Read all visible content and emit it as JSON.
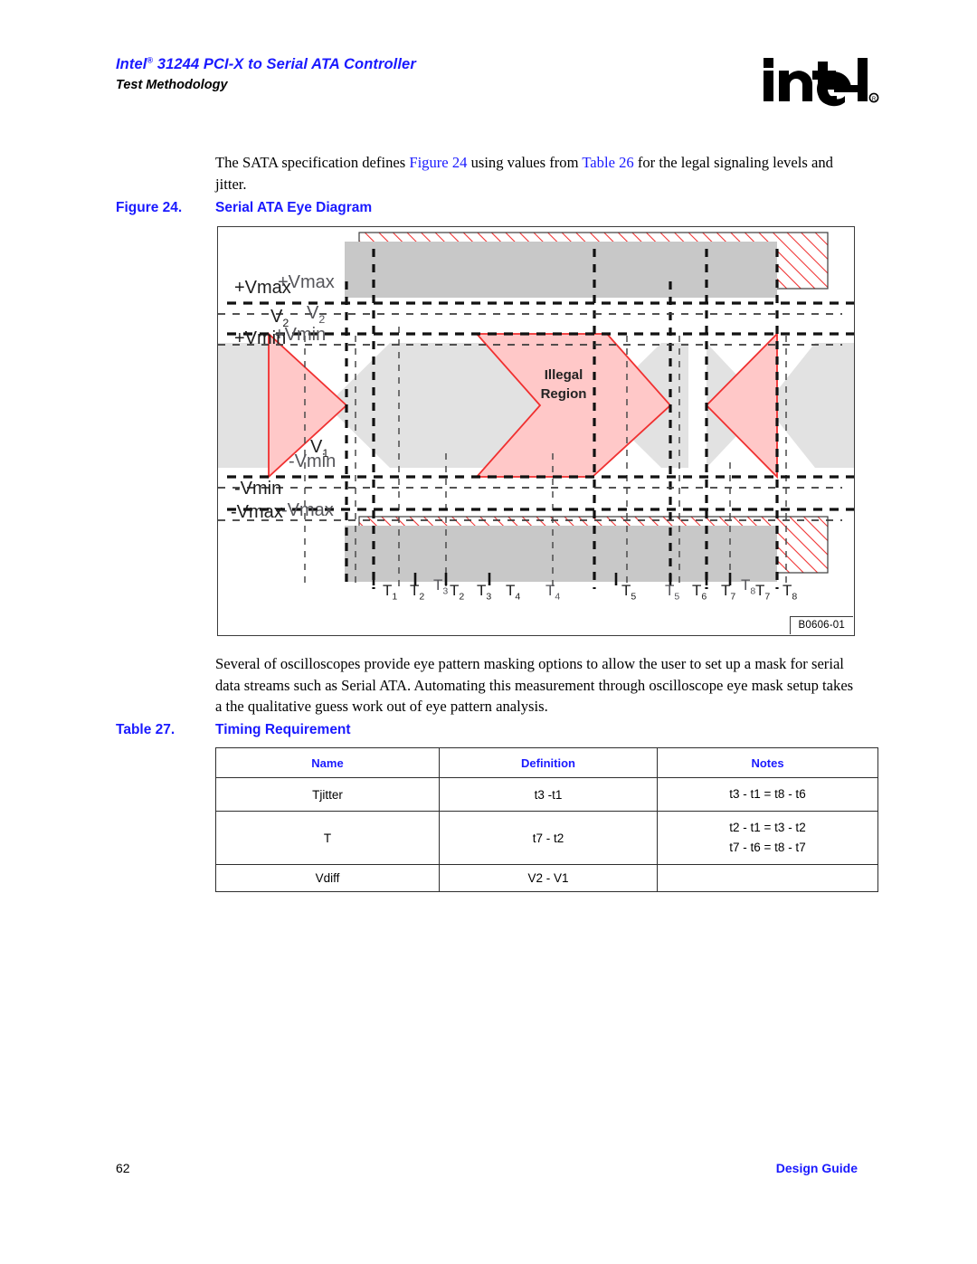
{
  "header": {
    "title_pre": "Intel",
    "title_sup": "®",
    "title_post": " 31244 PCI-X to Serial ATA Controller",
    "subtitle": "Test Methodology",
    "logo_name": "intel-logo",
    "logo_wordmark": "intel",
    "logo_registered": "®",
    "title_color": "#1a1aff"
  },
  "body": {
    "paragraph1_part1": "The SATA specification defines ",
    "paragraph1_xref1": "Figure 24",
    "paragraph1_part2": " using values from ",
    "paragraph1_xref2": "Table 26",
    "paragraph1_part3": " for the legal signaling levels and jitter.",
    "paragraph2": "Several of oscilloscopes provide eye pattern masking options to allow the user to set up a mask for serial data streams such as Serial ATA. Automating this measurement through oscilloscope eye mask setup takes a the qualitative guess work out of eye pattern analysis."
  },
  "figure": {
    "caption_number": "Figure 24.",
    "caption_title": "Serial ATA Eye Diagram",
    "figure_id": "B0606-01",
    "illegal_region_line1": "Illegal",
    "illegal_region_line2": "Region",
    "voltage_labels": [
      "+Vmax",
      "V2",
      "+Vmin",
      "V1",
      "-Vmin",
      "-Vmax"
    ],
    "time_labels": [
      "T1",
      "T2",
      "T3",
      "T4",
      "T5",
      "T6",
      "T7",
      "T8"
    ],
    "colors": {
      "mask_pink": "#ffc8c8",
      "mask_red_outline": "#f03030",
      "trace_gray": "#e2e2e2",
      "bar_gray": "#c8c8c8",
      "grid_black": "#111111"
    }
  },
  "table": {
    "caption_number": "Table 27.",
    "caption_title": "Timing Requirement",
    "headers": [
      "Name",
      "Definition",
      "Notes"
    ],
    "rows": [
      {
        "name": "Tjitter",
        "definition": "t3 -t1",
        "notes": [
          "t3 - t1 = t8 - t6"
        ]
      },
      {
        "name": "T",
        "definition": "t7 - t2",
        "notes": [
          "t2 - t1 = t3 - t2",
          "t7 - t6 = t8 - t7"
        ]
      },
      {
        "name": "Vdiff",
        "definition": "V2 - V1",
        "notes": []
      }
    ]
  },
  "footer": {
    "page_number": "62",
    "document_name": "Design Guide"
  }
}
